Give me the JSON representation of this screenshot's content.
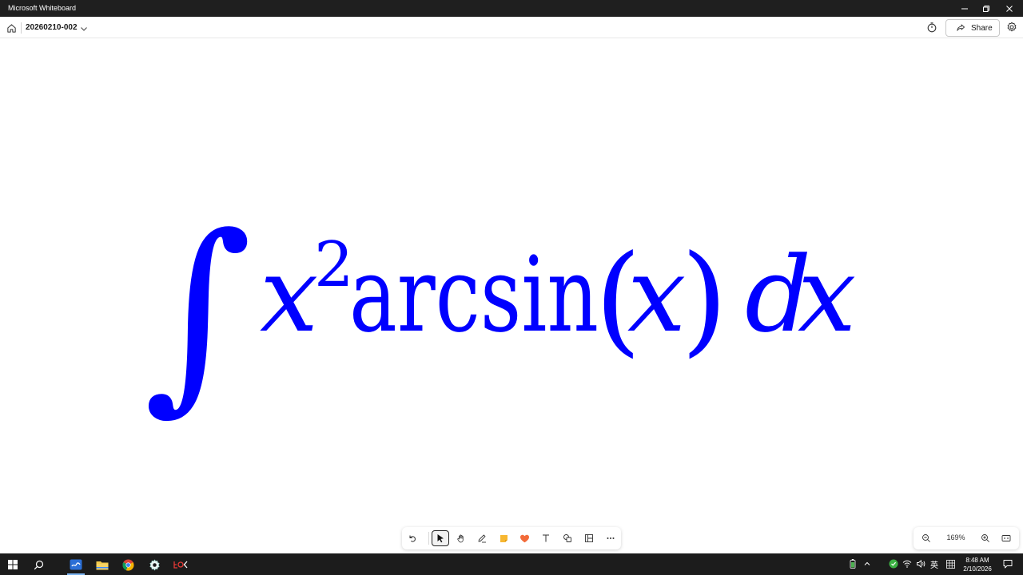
{
  "window": {
    "title": "Microsoft Whiteboard",
    "controls": [
      "minimize-icon",
      "restore-icon",
      "close-icon"
    ]
  },
  "header": {
    "home_icon": "home-icon",
    "board_title": "20260210-002",
    "chevron_icon": "chevron-down-icon",
    "timer_icon": "timer-icon",
    "share_label": "Share",
    "settings_icon": "gear-icon"
  },
  "canvas": {
    "formula": {
      "color": "#0000ff",
      "integral_sign": "∫",
      "base": "x",
      "exponent": "2",
      "function": "arcsin",
      "open_paren": "(",
      "argument": "x",
      "close_paren": ")",
      "differential_d": "d",
      "differential_var": "x"
    }
  },
  "toolbar": {
    "tools": [
      {
        "name": "undo",
        "icon": "undo-icon"
      },
      {
        "name": "select",
        "icon": "select-pointer-icon",
        "active": true
      },
      {
        "name": "pan",
        "icon": "hand-icon"
      },
      {
        "name": "pen",
        "icon": "pen-icon"
      },
      {
        "name": "sticky-note",
        "icon": "sticky-note-icon",
        "color": "#f7b731"
      },
      {
        "name": "reactions",
        "icon": "heart-icon",
        "color": "#f26b3a"
      },
      {
        "name": "text",
        "icon": "text-icon"
      },
      {
        "name": "shapes",
        "icon": "shapes-icon"
      },
      {
        "name": "templates",
        "icon": "templates-icon"
      },
      {
        "name": "more",
        "icon": "more-icon"
      }
    ]
  },
  "zoom": {
    "zoom_out_icon": "zoom-out-icon",
    "level": "169%",
    "zoom_in_icon": "zoom-in-icon",
    "fit_icon": "fit-to-screen-icon"
  },
  "taskbar": {
    "apps": [
      "windows-start-icon",
      "search-icon",
      "whiteboard-app-icon",
      "file-explorer-icon",
      "chrome-icon",
      "settings-app-icon",
      "obs-app-icon"
    ],
    "tray": {
      "ime_label": "英",
      "time": "8:48 AM",
      "date": "2/10/2026"
    }
  }
}
